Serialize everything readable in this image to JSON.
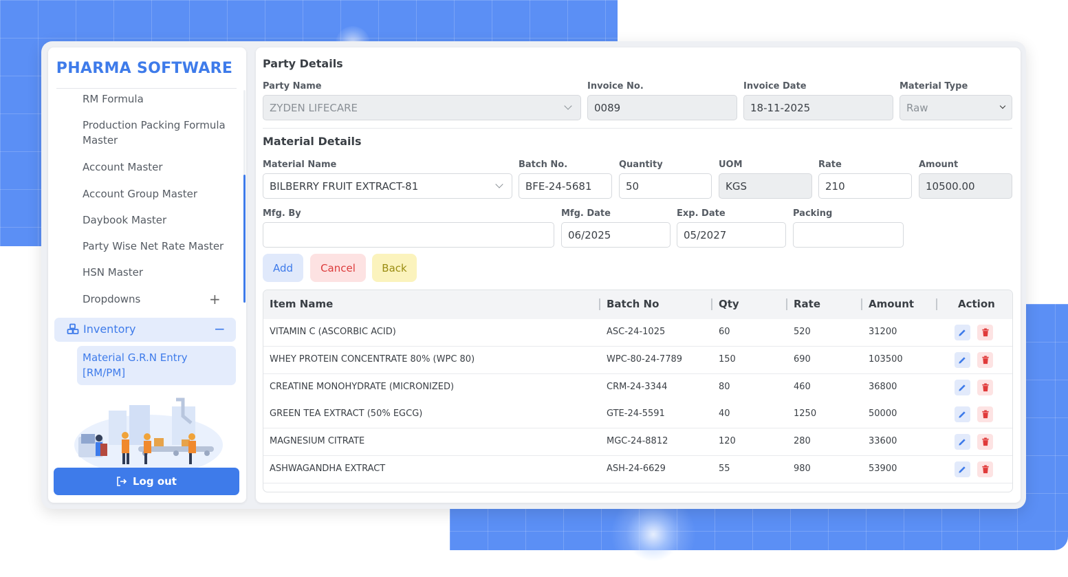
{
  "sidebar": {
    "brand": "PHARMA SOFTWARE",
    "items": [
      {
        "label": "RM Formula"
      },
      {
        "label": "Production Packing Formula Master"
      },
      {
        "label": "Account Master"
      },
      {
        "label": "Account Group Master"
      },
      {
        "label": "Daybook Master"
      },
      {
        "label": "Party Wise Net Rate Master"
      },
      {
        "label": "HSN Master"
      },
      {
        "label": "Dropdowns"
      }
    ],
    "inventory_label": "Inventory",
    "active_sub_item": "Material G.R.N Entry [RM/PM]",
    "logout_label": "Log out"
  },
  "party": {
    "title": "Party Details",
    "party_name_label": "Party Name",
    "party_name_value": "ZYDEN LIFECARE",
    "invoice_no_label": "Invoice No.",
    "invoice_no_value": "0089",
    "invoice_date_label": "Invoice Date",
    "invoice_date_value": "18-11-2025",
    "material_type_label": "Material Type",
    "material_type_value": "Raw"
  },
  "material": {
    "title": "Material Details",
    "material_name_label": "Material Name",
    "material_name_value": "BILBERRY FRUIT EXTRACT-81",
    "batch_no_label": "Batch No.",
    "batch_no_value": "BFE-24-5681",
    "quantity_label": "Quantity",
    "quantity_value": "50",
    "uom_label": "UOM",
    "uom_value": "KGS",
    "rate_label": "Rate",
    "rate_value": "210",
    "amount_label": "Amount",
    "amount_value": "10500.00",
    "mfg_by_label": "Mfg. By",
    "mfg_by_value": "",
    "mfg_date_label": "Mfg. Date",
    "mfg_date_value": "06/2025",
    "exp_date_label": "Exp. Date",
    "exp_date_value": "05/2027",
    "packing_label": "Packing",
    "packing_value": ""
  },
  "buttons": {
    "add": "Add",
    "cancel": "Cancel",
    "back": "Back"
  },
  "table": {
    "headers": [
      "Item Name",
      "Batch No",
      "Qty",
      "Rate",
      "Amount",
      "Action"
    ],
    "rows": [
      {
        "item": "VITAMIN C (ASCORBIC ACID)",
        "batch": "ASC-24-1025",
        "qty": "60",
        "rate": "520",
        "amount": "31200"
      },
      {
        "item": "WHEY PROTEIN CONCENTRATE 80% (WPC 80)",
        "batch": "WPC-80-24-7789",
        "qty": "150",
        "rate": "690",
        "amount": "103500"
      },
      {
        "item": "CREATINE MONOHYDRATE (MICRONIZED)",
        "batch": "CRM-24-3344",
        "qty": "80",
        "rate": "460",
        "amount": "36800"
      },
      {
        "item": "GREEN TEA EXTRACT (50% EGCG)",
        "batch": "GTE-24-5591",
        "qty": "40",
        "rate": "1250",
        "amount": "50000"
      },
      {
        "item": "MAGNESIUM CITRATE",
        "batch": "MGC-24-8812",
        "qty": "120",
        "rate": "280",
        "amount": "33600"
      },
      {
        "item": "ASHWAGANDHA EXTRACT",
        "batch": "ASH-24-6629",
        "qty": "55",
        "rate": "980",
        "amount": "53900"
      }
    ]
  },
  "icons": {
    "edit": "pencil-icon",
    "delete": "trash-icon",
    "inventory": "boxes-icon",
    "logout": "logout-icon",
    "expand": "plus-icon",
    "collapse": "minus-icon"
  },
  "colors": {
    "accent": "#3e7bea",
    "danger": "#dc3b3b",
    "warning_bg": "#fbf3bd",
    "background_blue": "#5b8ff5"
  }
}
